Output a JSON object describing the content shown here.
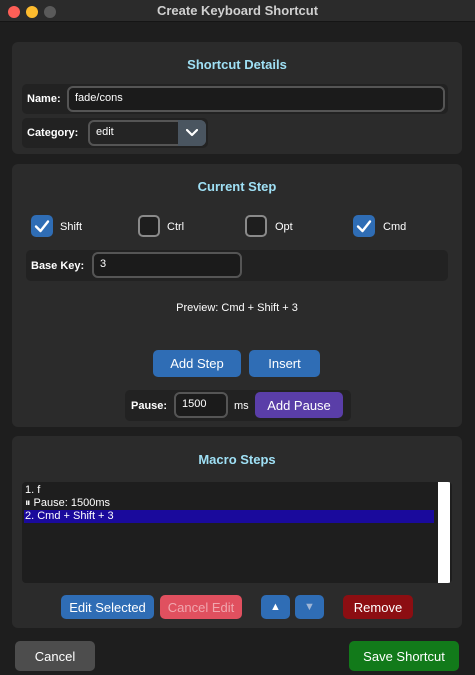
{
  "window": {
    "title": "Create Keyboard Shortcut"
  },
  "shortcut_details": {
    "title": "Shortcut Details",
    "name_label": "Name:",
    "name_value": "fade/cons",
    "category_label": "Category:",
    "category_value": "edit"
  },
  "current_step": {
    "title": "Current Step",
    "modifiers": [
      {
        "label": "Shift",
        "checked": true
      },
      {
        "label": "Ctrl",
        "checked": false
      },
      {
        "label": "Opt",
        "checked": false
      },
      {
        "label": "Cmd",
        "checked": true
      }
    ],
    "base_key_label": "Base Key:",
    "base_key_value": "3",
    "preview": "Preview: Cmd + Shift + 3",
    "add_step_label": "Add Step",
    "insert_label": "Insert",
    "pause_label": "Pause:",
    "pause_value": "1500",
    "pause_unit": "ms",
    "add_pause_label": "Add Pause"
  },
  "macro_steps": {
    "title": "Macro Steps",
    "items": [
      {
        "text": "1. f",
        "selected": false
      },
      {
        "text": "⏸ Pause: 1500ms",
        "selected": false
      },
      {
        "text": "2. Cmd + Shift + 3",
        "selected": true
      }
    ],
    "edit_selected_label": "Edit Selected",
    "cancel_edit_label": "Cancel Edit",
    "move_up_label": "▲",
    "move_down_label": "▼",
    "remove_label": "Remove"
  },
  "footer": {
    "cancel_label": "Cancel",
    "save_label": "Save Shortcut"
  },
  "colors": {
    "accent_blue": "#2f6db5",
    "section_title": "#9fe0f5",
    "save_green": "#127a1a",
    "remove_red": "#8c0e12",
    "selection": "#1a0a9c"
  }
}
